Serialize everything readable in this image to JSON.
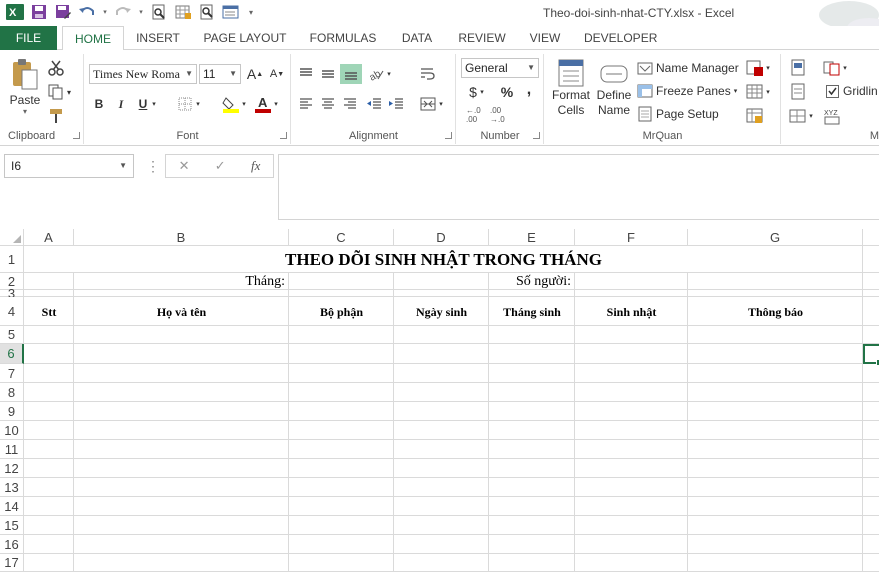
{
  "window": {
    "title": "Theo-doi-sinh-nhat-CTY.xlsx - Excel"
  },
  "tabs": [
    "FILE",
    "HOME",
    "INSERT",
    "PAGE LAYOUT",
    "FORMULAS",
    "DATA",
    "REVIEW",
    "VIEW",
    "DEVELOPER"
  ],
  "ribbon": {
    "clipboard": {
      "label": "Clipboard",
      "paste": "Paste"
    },
    "font": {
      "label": "Font",
      "name": "Times New Roma",
      "size": "11",
      "bold": "B",
      "italic": "I",
      "underline": "U",
      "grow": "A",
      "shrink": "A"
    },
    "alignment": {
      "label": "Alignment"
    },
    "number": {
      "label": "Number",
      "format": "General",
      "currency": "$",
      "percent": "%",
      "comma": ",",
      "inc_decimal": "←.0\n.00",
      "dec_decimal": ".00\n→.0"
    },
    "mrquan": {
      "label": "MrQuan",
      "format_cells": "Format Cells",
      "define_name": "Define Name",
      "name_manager": "Name Manager",
      "freeze_panes": "Freeze Panes",
      "page_setup": "Page Setup"
    },
    "more": {
      "gridlines": "Gridlin",
      "label": "M"
    }
  },
  "formula_bar": {
    "name_box": "I6",
    "cancel": "✕",
    "enter": "✓",
    "fx": "fx",
    "value": ""
  },
  "sheet": {
    "columns": [
      "A",
      "B",
      "C",
      "D",
      "E",
      "F",
      "G"
    ],
    "rows": [
      "1",
      "2",
      "3",
      "4",
      "5",
      "6",
      "7",
      "8",
      "9",
      "10",
      "11",
      "12",
      "13",
      "14",
      "15",
      "16",
      "17"
    ],
    "title": "THEO DÕI SINH NHẬT TRONG THÁNG",
    "month_label": "Tháng:",
    "count_label": "Số người:",
    "headers": [
      "Stt",
      "Họ và tên",
      "Bộ phận",
      "Ngày sinh",
      "Tháng sinh",
      "Sinh nhật",
      "Thông báo"
    ]
  },
  "colors": {
    "accent": "#217346",
    "grid": "#dadada"
  }
}
